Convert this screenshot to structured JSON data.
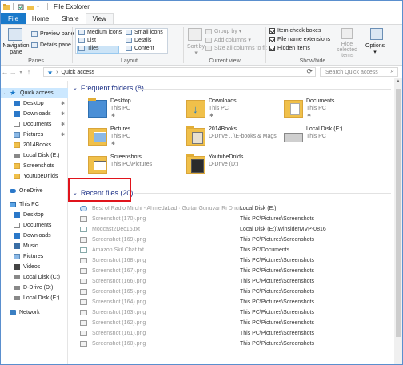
{
  "window": {
    "title": "File Explorer"
  },
  "tabs": [
    "File",
    "Home",
    "Share",
    "View"
  ],
  "ribbon": {
    "panes": {
      "navigation_pane": "Navigation pane",
      "preview_pane": "Preview pane",
      "details_pane": "Details pane",
      "label": "Panes"
    },
    "layout": {
      "items": [
        "Medium icons",
        "Small icons",
        "List",
        "Details",
        "Tiles",
        "Content"
      ],
      "selected": "Tiles",
      "label": "Layout"
    },
    "current_view": {
      "sort_by": "Sort by",
      "group_by": "Group by",
      "add_columns": "Add columns",
      "size_all_columns": "Size all columns to fit",
      "label": "Current view"
    },
    "show_hide": {
      "item_check_boxes": "Item check boxes",
      "file_name_extensions": "File name extensions",
      "hidden_items": "Hidden items",
      "hide_selected": "Hide selected items",
      "label": "Show/hide"
    },
    "options": "Options"
  },
  "address": {
    "path": "Quick access",
    "search_placeholder": "Search Quick access"
  },
  "nav": [
    {
      "label": "Quick access",
      "icon": "star-icon",
      "pinned": false
    },
    {
      "label": "Desktop",
      "icon": "desktop-icon",
      "pinned": true
    },
    {
      "label": "Downloads",
      "icon": "download-icon",
      "pinned": true
    },
    {
      "label": "Documents",
      "icon": "documents-icon",
      "pinned": true
    },
    {
      "label": "Pictures",
      "icon": "pictures-icon",
      "pinned": true
    },
    {
      "label": "2014Books",
      "icon": "folder-icon",
      "pinned": false
    },
    {
      "label": "Local Disk (E:)",
      "icon": "drive-icon",
      "pinned": false
    },
    {
      "label": "Screenshots",
      "icon": "folder-icon",
      "pinned": false
    },
    {
      "label": "YoutubeDnlds",
      "icon": "folder-icon",
      "pinned": false
    },
    {
      "label": "OneDrive",
      "icon": "onedrive-icon",
      "pinned": false
    },
    {
      "label": "This PC",
      "icon": "pc-icon",
      "pinned": false
    },
    {
      "label": "Desktop",
      "icon": "desktop-icon",
      "pinned": false
    },
    {
      "label": "Documents",
      "icon": "documents-icon",
      "pinned": false
    },
    {
      "label": "Downloads",
      "icon": "download-icon",
      "pinned": false
    },
    {
      "label": "Music",
      "icon": "music-icon",
      "pinned": false
    },
    {
      "label": "Pictures",
      "icon": "pictures-icon",
      "pinned": false
    },
    {
      "label": "Videos",
      "icon": "videos-icon",
      "pinned": false
    },
    {
      "label": "Local Disk (C:)",
      "icon": "drive-icon",
      "pinned": false
    },
    {
      "label": "D-Drive (D:)",
      "icon": "drive-icon",
      "pinned": false
    },
    {
      "label": "Local Disk (E:)",
      "icon": "drive-icon",
      "pinned": false
    },
    {
      "label": "Network",
      "icon": "network-icon",
      "pinned": false
    }
  ],
  "frequent": {
    "heading": "Frequent folders (8)",
    "items": [
      {
        "name": "Desktop",
        "sub": "This PC",
        "pinned": true
      },
      {
        "name": "Downloads",
        "sub": "This PC",
        "pinned": true
      },
      {
        "name": "Documents",
        "sub": "This PC",
        "pinned": true
      },
      {
        "name": "Pictures",
        "sub": "This PC",
        "pinned": true
      },
      {
        "name": "2014Books",
        "sub": "D-Drive ...\\E-books & Mags",
        "pinned": false
      },
      {
        "name": "Local Disk (E:)",
        "sub": "This PC",
        "pinned": false
      },
      {
        "name": "Screenshots",
        "sub": "This PC\\Pictures",
        "pinned": false
      },
      {
        "name": "YoutubeDnlds",
        "sub": "D-Drive (D:)",
        "pinned": false
      }
    ]
  },
  "recent": {
    "heading": "Recent files (20)",
    "items": [
      {
        "name": "Best of Radio Mirchi - Ahmedabad · Guitar Gunuvar Ri Dhcis...",
        "location": "Local Disk (E:)"
      },
      {
        "name": "Screenshot (170).png",
        "location": "This PC\\Pictures\\Screenshots"
      },
      {
        "name": "Modcast2Dec16.txt",
        "location": "Local Disk (E:)\\WinsiderMVP-0816"
      },
      {
        "name": "Screenshot (169).png",
        "location": "This PC\\Pictures\\Screenshots"
      },
      {
        "name": "Amazon Skil Chat.txt",
        "location": "This PC\\Documents"
      },
      {
        "name": "Screenshot (168).png",
        "location": "This PC\\Pictures\\Screenshots"
      },
      {
        "name": "Screenshot (167).png",
        "location": "This PC\\Pictures\\Screenshots"
      },
      {
        "name": "Screenshot (166).png",
        "location": "This PC\\Pictures\\Screenshots"
      },
      {
        "name": "Screenshot (165).png",
        "location": "This PC\\Pictures\\Screenshots"
      },
      {
        "name": "Screenshot (164).png",
        "location": "This PC\\Pictures\\Screenshots"
      },
      {
        "name": "Screenshot (163).png",
        "location": "This PC\\Pictures\\Screenshots"
      },
      {
        "name": "Screenshot (162).png",
        "location": "This PC\\Pictures\\Screenshots"
      },
      {
        "name": "Screenshot (161).png",
        "location": "This PC\\Pictures\\Screenshots"
      },
      {
        "name": "Screenshot (160).png",
        "location": "This PC\\Pictures\\Screenshots"
      }
    ]
  }
}
